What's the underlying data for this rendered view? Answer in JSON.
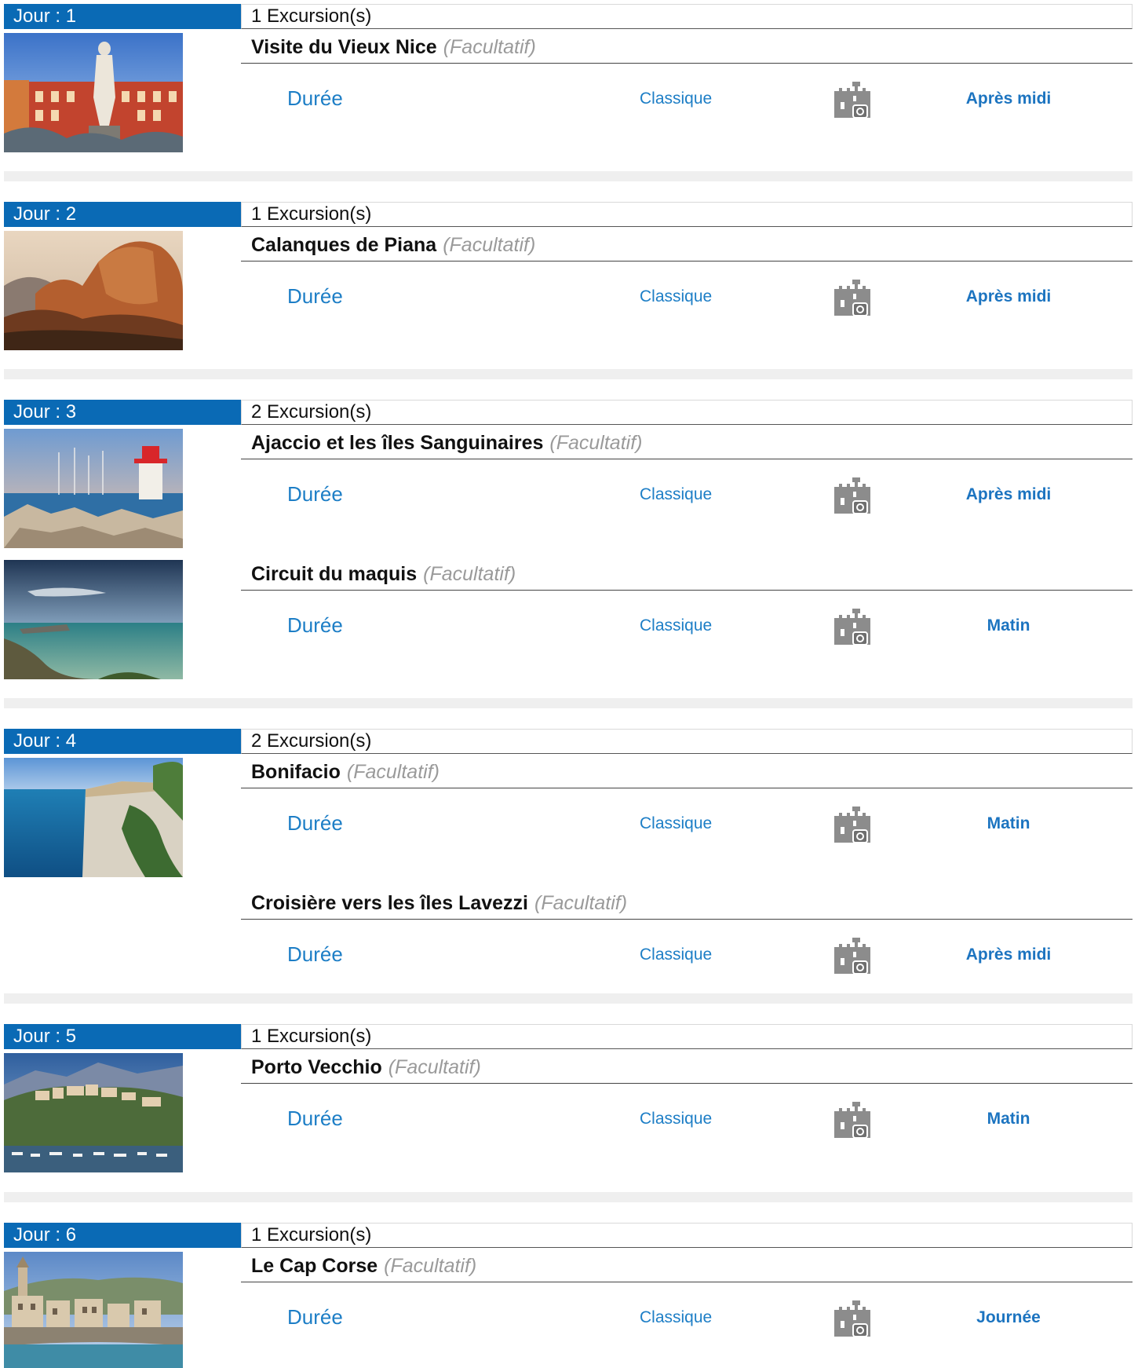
{
  "days": [
    {
      "label": "Jour : 1",
      "count": "1 Excursion(s)",
      "excursions": [
        {
          "title": "Visite du Vieux Nice",
          "optional": "(Facultatif)",
          "duration_label": "Durée",
          "type": "Classique",
          "icon": "castle-camera-icon",
          "period": "Après midi",
          "image": "nice-statue"
        }
      ]
    },
    {
      "label": "Jour : 2",
      "count": "1 Excursion(s)",
      "excursions": [
        {
          "title": "Calanques de Piana",
          "optional": "(Facultatif)",
          "duration_label": "Durée",
          "type": "Classique",
          "icon": "castle-camera-icon",
          "period": "Après midi",
          "image": "piana-rocks"
        }
      ]
    },
    {
      "label": "Jour : 3",
      "count": "2 Excursion(s)",
      "excursions": [
        {
          "title": "Ajaccio et les îles Sanguinaires",
          "optional": "(Facultatif)",
          "duration_label": "Durée",
          "type": "Classique",
          "icon": "castle-camera-icon",
          "period": "Après midi",
          "image": "ajaccio-lighthouse"
        },
        {
          "title": "Circuit du maquis",
          "optional": "(Facultatif)",
          "duration_label": "Durée",
          "type": "Classique",
          "icon": "castle-camera-icon",
          "period": "Matin",
          "image": "maquis-coast"
        }
      ]
    },
    {
      "label": "Jour : 4",
      "count": "2 Excursion(s)",
      "excursions": [
        {
          "title": "Bonifacio",
          "optional": "(Facultatif)",
          "duration_label": "Durée",
          "type": "Classique",
          "icon": "castle-camera-icon",
          "period": "Matin",
          "image": "bonifacio-cliffs"
        },
        {
          "title": "Croisière vers les îles Lavezzi",
          "optional": "(Facultatif)",
          "duration_label": "Durée",
          "type": "Classique",
          "icon": "castle-camera-icon",
          "period": "Après midi",
          "image": ""
        }
      ]
    },
    {
      "label": "Jour : 5",
      "count": "1 Excursion(s)",
      "excursions": [
        {
          "title": "Porto Vecchio",
          "optional": "(Facultatif)",
          "duration_label": "Durée",
          "type": "Classique",
          "icon": "castle-camera-icon",
          "period": "Matin",
          "image": "porto-vecchio-town"
        }
      ]
    },
    {
      "label": "Jour : 6",
      "count": "1 Excursion(s)",
      "excursions": [
        {
          "title": "Le Cap Corse",
          "optional": "(Facultatif)",
          "duration_label": "Durée",
          "type": "Classique",
          "icon": "castle-camera-icon",
          "period": "Journée",
          "image": "cap-corse-village"
        }
      ]
    }
  ],
  "colors": {
    "day_header_bg": "#0a6ab5",
    "link_blue": "#1d7ec6",
    "separator": "#efefef",
    "optional_grey": "#9a9a9a"
  }
}
